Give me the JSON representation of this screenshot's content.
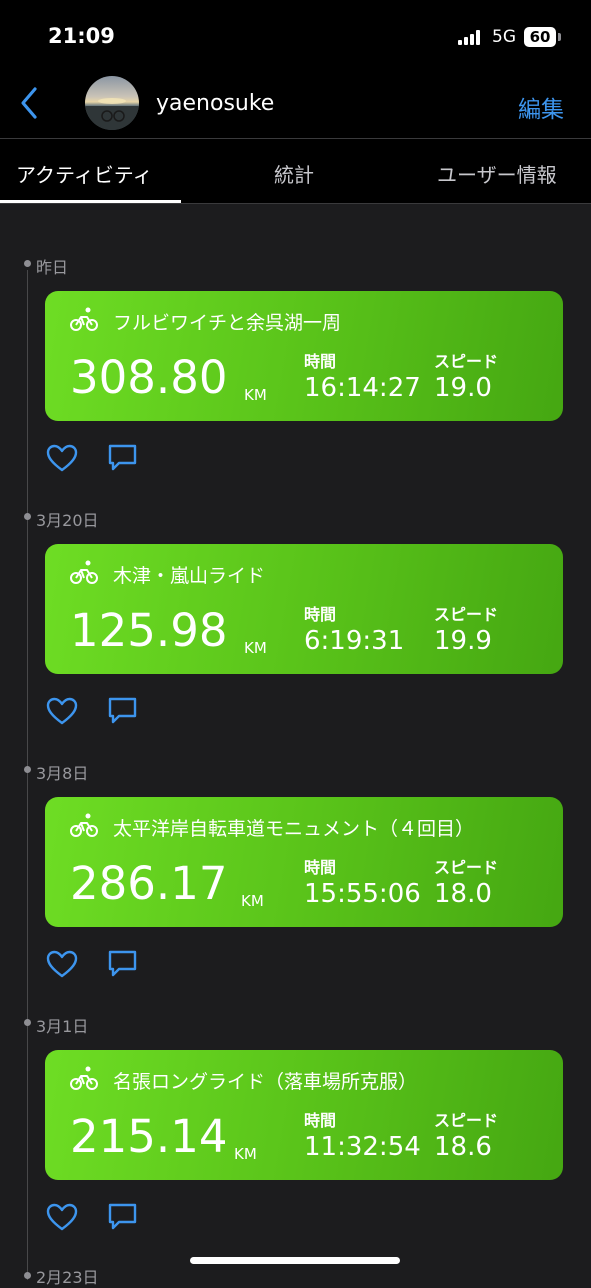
{
  "status_bar": {
    "time": "21:09",
    "network": "5G",
    "battery": "60"
  },
  "header": {
    "username": "yaenosuke",
    "edit_label": "編集"
  },
  "tabs": [
    {
      "label": "アクティビティ"
    },
    {
      "label": "統計"
    },
    {
      "label": "ユーザー情報"
    }
  ],
  "activities": [
    {
      "date": "昨日",
      "title": "フルビワイチと余呉湖一周",
      "distance": "308.80",
      "unit": "KM",
      "time_label": "時間",
      "time": "16:14:27",
      "speed_label": "スピード",
      "speed": "19.0"
    },
    {
      "date": "3月20日",
      "title": "木津・嵐山ライド",
      "distance": "125.98",
      "unit": "KM",
      "time_label": "時間",
      "time": "6:19:31",
      "speed_label": "スピード",
      "speed": "19.9"
    },
    {
      "date": "3月8日",
      "title": "太平洋岸自転車道モニュメント（４回目）",
      "distance": "286.17",
      "unit": "KM",
      "time_label": "時間",
      "time": "15:55:06",
      "speed_label": "スピード",
      "speed": "18.0"
    },
    {
      "date": "3月1日",
      "title": "名張ロングライド（落車場所克服）",
      "distance": "215.14",
      "unit": "KM",
      "time_label": "時間",
      "time": "11:32:54",
      "speed_label": "スピード",
      "speed": "18.6"
    }
  ],
  "next_date": "2月23日",
  "colors": {
    "accent": "#3d95ee",
    "card_green": "#5cc51b",
    "background": "#1c1c1e"
  },
  "icons": [
    "back-chevron-icon",
    "bicycle-icon",
    "heart-icon",
    "comment-icon"
  ]
}
